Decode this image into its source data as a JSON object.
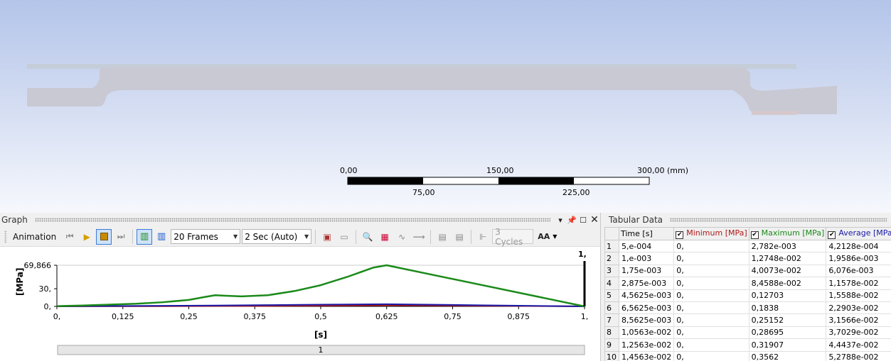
{
  "viewport": {
    "scale_labels": {
      "top": [
        "0,00",
        "150,00",
        "300,00 (mm)"
      ],
      "bottom": [
        "75,00",
        "225,00"
      ]
    }
  },
  "graph": {
    "title": "Graph",
    "header_buttons": [
      "dropdown",
      "pin",
      "maximize",
      "close"
    ],
    "toolbar": {
      "animation_label": "Animation",
      "frames": "20 Frames",
      "duration": "2 Sec (Auto)",
      "cycles": "3 Cycles",
      "aa_label": "AA"
    },
    "bottom_bar_label": "1",
    "marker_label": "1,"
  },
  "chart_data": {
    "type": "line",
    "xlabel": "[s]",
    "ylabel": "[MPa]",
    "xlim": [
      0,
      1
    ],
    "ylim": [
      0,
      69.866
    ],
    "x_ticks": [
      "0,",
      "0,125",
      "0,25",
      "0,375",
      "0,5",
      "0,625",
      "0,75",
      "0,875",
      "1,"
    ],
    "y_ticks": [
      "0,",
      "30,",
      "69,866"
    ],
    "series": [
      {
        "name": "Maximum [MPa]",
        "color": "#1a8a1a",
        "x": [
          0,
          0.05,
          0.1,
          0.15,
          0.2,
          0.25,
          0.28,
          0.3,
          0.32,
          0.35,
          0.4,
          0.45,
          0.5,
          0.55,
          0.6,
          0.625,
          1.0
        ],
        "y": [
          0.5,
          1.5,
          3,
          4.5,
          7,
          11,
          16,
          19,
          18,
          17,
          19,
          26,
          36,
          50,
          66,
          69.866,
          0
        ]
      },
      {
        "name": "Average [MPa]",
        "color": "#1a1aa8",
        "x": [
          0,
          0.1,
          0.2,
          0.3,
          0.4,
          0.5,
          0.6,
          0.625,
          0.8,
          1.0
        ],
        "y": [
          0.2,
          0.6,
          1.0,
          1.5,
          2.2,
          3.0,
          3.6,
          3.8,
          2.0,
          0
        ]
      },
      {
        "name": "Minimum [MPa]",
        "color": "#b01818",
        "x": [
          0,
          0.2,
          0.4,
          0.6,
          0.625,
          1.0
        ],
        "y": [
          0,
          0.3,
          0.8,
          1.8,
          2.0,
          0
        ]
      }
    ]
  },
  "tabular": {
    "title": "Tabular Data",
    "headers": {
      "time": "Time [s]",
      "minimum": "Minimum [MPa]",
      "maximum": "Maximum [MPa]",
      "average": "Average [MPa]"
    },
    "header_colors": {
      "minimum": "#b01818",
      "maximum": "#1a8a1a",
      "average": "#1a1aa8"
    },
    "rows": [
      [
        "1",
        "5,e-004",
        "0,",
        "2,782e-003",
        "4,2128e-004"
      ],
      [
        "2",
        "1,e-003",
        "0,",
        "1,2748e-002",
        "1,9586e-003"
      ],
      [
        "3",
        "1,75e-003",
        "0,",
        "4,0073e-002",
        "6,076e-003"
      ],
      [
        "4",
        "2,875e-003",
        "0,",
        "8,4588e-002",
        "1,1578e-002"
      ],
      [
        "5",
        "4,5625e-003",
        "0,",
        "0,12703",
        "1,5588e-002"
      ],
      [
        "6",
        "6,5625e-003",
        "0,",
        "0,1838",
        "2,2903e-002"
      ],
      [
        "7",
        "8,5625e-003",
        "0,",
        "0,25152",
        "3,1566e-002"
      ],
      [
        "8",
        "1,0563e-002",
        "0,",
        "0,28695",
        "3,7029e-002"
      ],
      [
        "9",
        "1,2563e-002",
        "0,",
        "0,31907",
        "4,4437e-002"
      ],
      [
        "10",
        "1,4563e-002",
        "0,",
        "0,3562",
        "5,2788e-002"
      ]
    ]
  }
}
